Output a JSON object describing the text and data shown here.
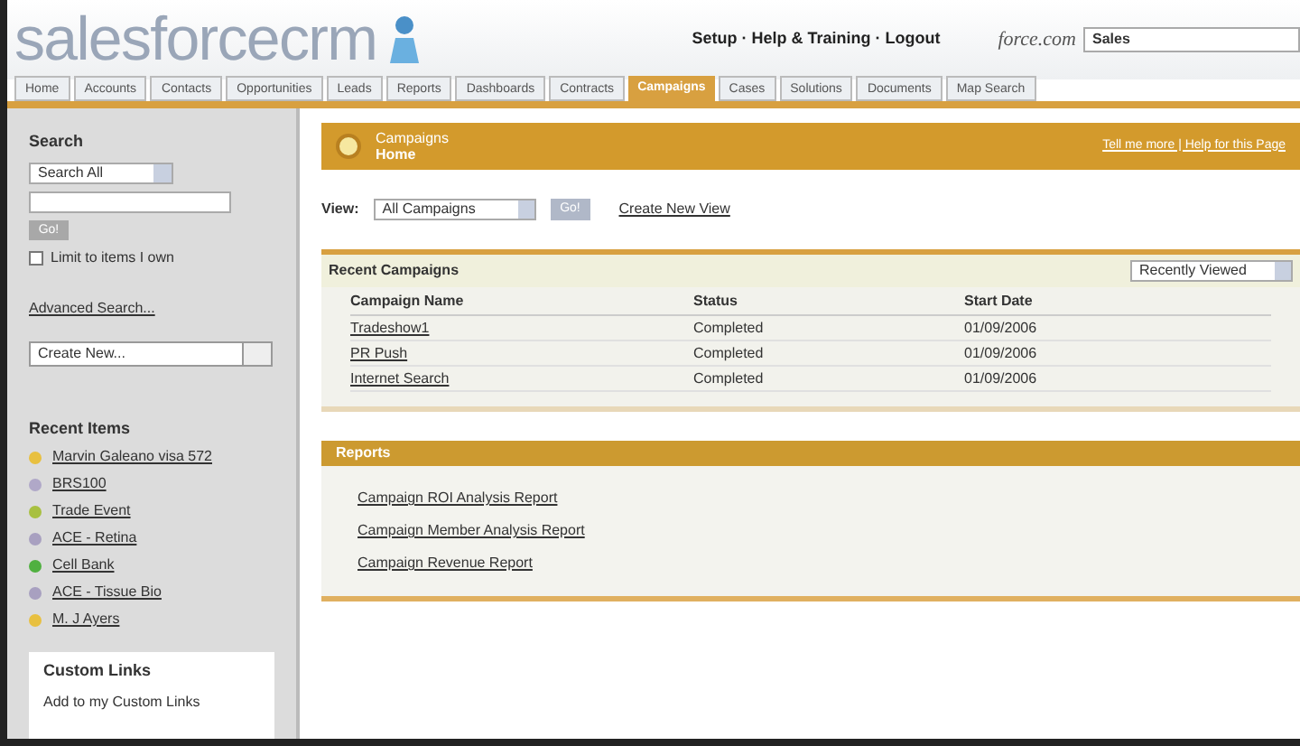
{
  "header": {
    "logo": "salesforcecrm",
    "partner_logo": "force.com",
    "user_links": "Setup · Help & Training · Logout",
    "search_value": "Sales"
  },
  "tabs": [
    {
      "label": "Home",
      "selected": false
    },
    {
      "label": "Accounts",
      "selected": false
    },
    {
      "label": "Contacts",
      "selected": false
    },
    {
      "label": "Opportunities",
      "selected": false
    },
    {
      "label": "Leads",
      "selected": false
    },
    {
      "label": "Reports",
      "selected": false
    },
    {
      "label": "Dashboards",
      "selected": false
    },
    {
      "label": "Contracts",
      "selected": false
    },
    {
      "label": "Campaigns",
      "selected": true
    },
    {
      "label": "Cases",
      "selected": false
    },
    {
      "label": "Solutions",
      "selected": false
    },
    {
      "label": "Documents",
      "selected": false
    },
    {
      "label": "Map Search",
      "selected": false
    }
  ],
  "sidebar": {
    "search_title": "Search",
    "search_scope": "Search All",
    "go": "Go!",
    "limit_label": "Limit to items I own",
    "limit_checked": false,
    "advanced": "Advanced Search...",
    "create_new": "Create New...",
    "recent_title": "Recent Items",
    "recent_items": [
      {
        "label": "Marvin Galeano visa 572",
        "color": "#e8c040"
      },
      {
        "label": "BRS100",
        "color": "#b0a8c8"
      },
      {
        "label": "Trade Event",
        "color": "#a8c040"
      },
      {
        "label": "ACE - Retina",
        "color": "#a8a0c0"
      },
      {
        "label": "Cell Bank",
        "color": "#50b040"
      },
      {
        "label": "ACE - Tissue Bio",
        "color": "#a8a0c0"
      },
      {
        "label": "M. J Ayers",
        "color": "#e8c040"
      }
    ],
    "custom_title": "Custom Links",
    "custom_links": [
      "Add to my Custom Links"
    ]
  },
  "page": {
    "title": "Campaigns",
    "subtitle": "Home",
    "help": "Tell me more | Help for this Page",
    "view_label": "View:",
    "view_value": "All Campaigns",
    "go": "Go!",
    "create_view": "Create New View"
  },
  "recent": {
    "title": "Recent Campaigns",
    "filter": "Recently Viewed",
    "columns": [
      "Campaign Name",
      "Status",
      "Start Date"
    ],
    "rows": [
      [
        "Tradeshow1",
        "Completed",
        "01/09/2006"
      ],
      [
        "PR Push",
        "Completed",
        "01/09/2006"
      ],
      [
        "Internet Search",
        "Completed",
        "01/09/2006"
      ]
    ]
  },
  "reports": {
    "title": "Reports",
    "links": [
      "Campaign ROI Analysis Report",
      "Campaign Member Analysis Report",
      "Campaign Revenue Report"
    ]
  }
}
